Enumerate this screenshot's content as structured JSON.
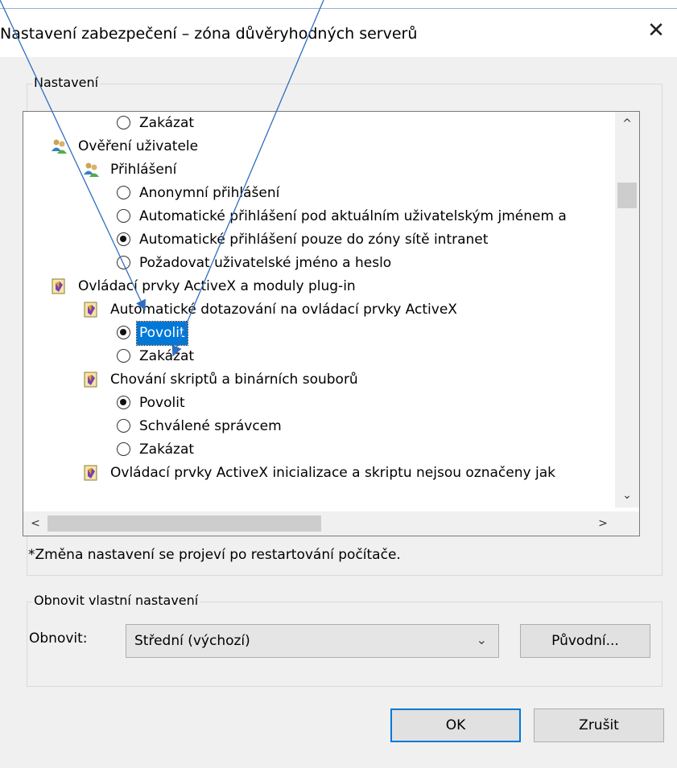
{
  "window": {
    "title": "Nastavení zabezpečení – zóna důvěryhodných serverů",
    "close_glyph": "✕"
  },
  "settings_group": {
    "label": "Nastavení",
    "tree": [
      {
        "kind": "radio",
        "label": "Zakázat",
        "checked": false
      },
      {
        "kind": "category",
        "icon": "users-icon",
        "label": "Ověření uživatele"
      },
      {
        "kind": "setting",
        "icon": "users-icon",
        "label": "Přihlášení"
      },
      {
        "kind": "radio",
        "label": "Anonymní přihlášení",
        "checked": false
      },
      {
        "kind": "radio",
        "label": "Automatické přihlášení pod aktuálním uživatelským jménem a",
        "checked": false
      },
      {
        "kind": "radio",
        "label": "Automatické přihlášení pouze do zóny sítě intranet",
        "checked": true
      },
      {
        "kind": "radio",
        "label": "Požadovat uživatelské jméno a heslo",
        "checked": false
      },
      {
        "kind": "category",
        "icon": "activex-icon",
        "label": "Ovládací prvky ActiveX a moduly plug-in"
      },
      {
        "kind": "setting",
        "icon": "activex-icon",
        "label": "Automatické dotazování na ovládací prvky ActiveX"
      },
      {
        "kind": "radio",
        "label": "Povolit",
        "checked": true,
        "selected": true
      },
      {
        "kind": "radio",
        "label": "Zakázat",
        "checked": false
      },
      {
        "kind": "setting",
        "icon": "activex-icon",
        "label": "Chování skriptů a binárních souborů"
      },
      {
        "kind": "radio",
        "label": "Povolit",
        "checked": true
      },
      {
        "kind": "radio",
        "label": "Schválené správcem",
        "checked": false
      },
      {
        "kind": "radio",
        "label": "Zakázat",
        "checked": false
      },
      {
        "kind": "setting",
        "icon": "activex-icon",
        "label": "Ovládací prvky ActiveX inicializace a skriptu nejsou označeny jak"
      }
    ],
    "note": "*Změna nastavení se projeví po restartování počítače."
  },
  "reset_group": {
    "label": "Obnovit vlastní nastavení",
    "reset_label": "Obnovit:",
    "reset_value": "Střední (výchozí)",
    "reset_button": "Původní..."
  },
  "buttons": {
    "ok": "OK",
    "cancel": "Zrušit"
  },
  "scrollbar_glyphs": {
    "up": "^",
    "down": "⌄",
    "left": "<",
    "right": ">",
    "combo": "⌄"
  },
  "colors": {
    "selection": "#0078d7",
    "annotation_line": "#2e6fc0"
  }
}
